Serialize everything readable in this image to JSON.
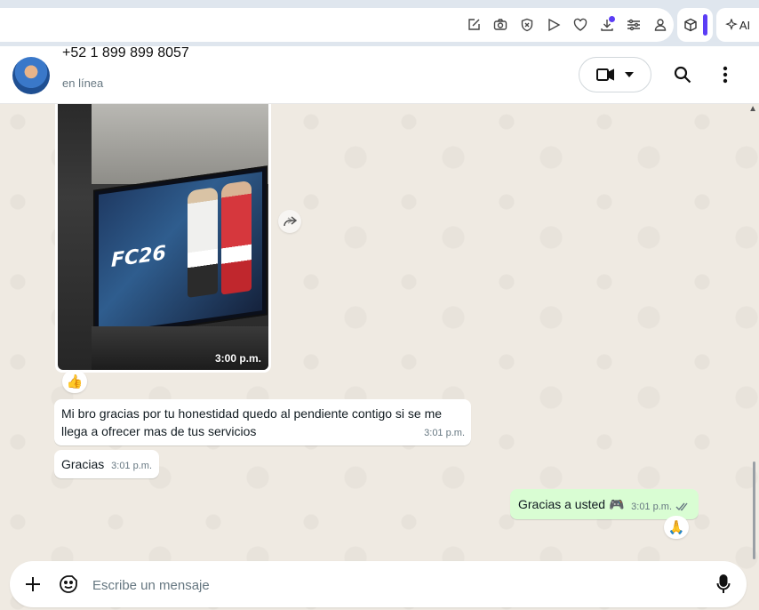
{
  "browser": {
    "toolbar_icons": [
      "edit-icon",
      "camera-icon",
      "shield-icon",
      "play-icon",
      "heart-icon",
      "download-icon",
      "sliders-icon",
      "profile-icon"
    ],
    "ai_label": "AI",
    "accent": "#5b3df5"
  },
  "header": {
    "contact_name": "+52 1 899 899 8057",
    "status": "en línea"
  },
  "messages": {
    "image": {
      "time": "3:00 p.m.",
      "reaction": "👍"
    },
    "m1": {
      "text": "Mi bro gracias por tu honestidad quedo al pendiente contigo si se me llega a ofrecer mas de tus servicios",
      "time": "3:01 p.m."
    },
    "m2": {
      "text": "Gracias",
      "time": "3:01 p.m."
    },
    "m3": {
      "text": "Gracias a usted 🎮",
      "time": "3:01 p.m.",
      "reaction": "🙏"
    }
  },
  "composer": {
    "placeholder": "Escribe un mensaje"
  },
  "colors": {
    "outgoing_bubble": "#d9fdd3",
    "incoming_bubble": "#ffffff",
    "chat_background": "#efeae2",
    "read_ticks": "#667781"
  }
}
